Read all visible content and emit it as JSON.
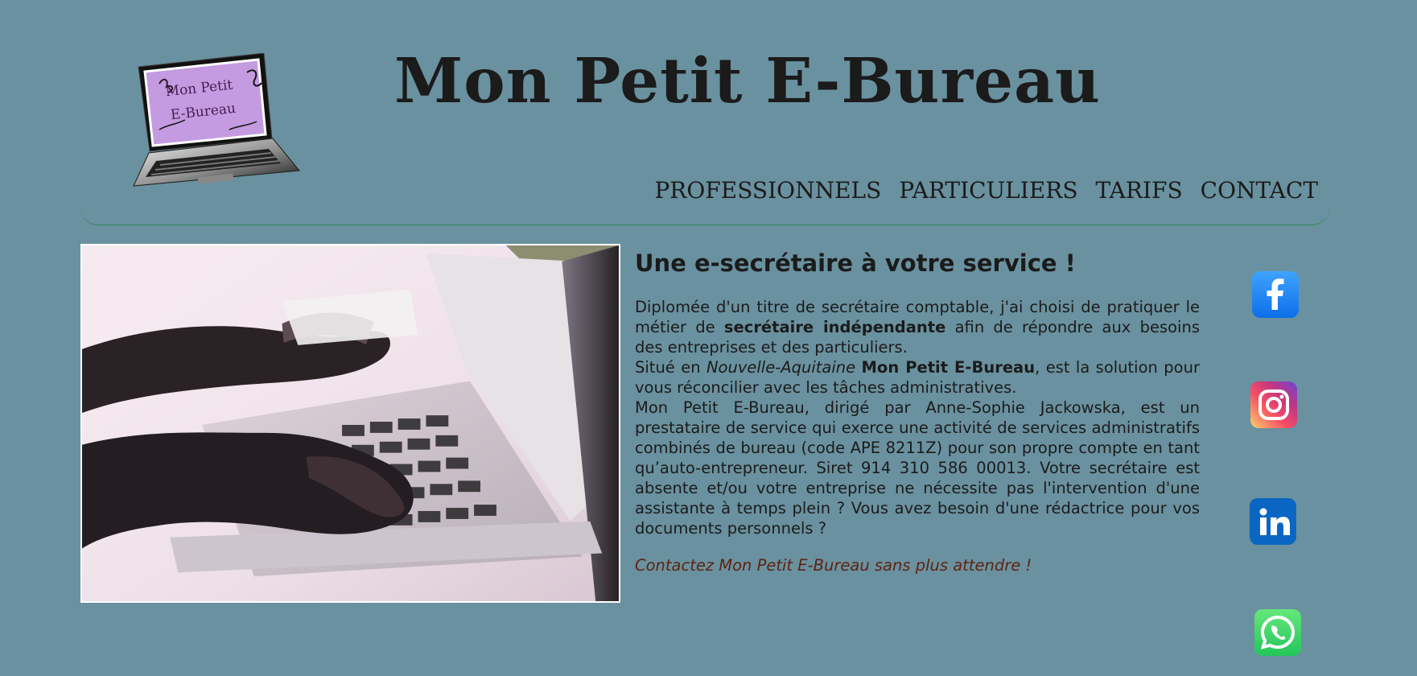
{
  "site": {
    "title": "Mon Petit E-Bureau",
    "logo_text": [
      "Mon Petit",
      "E-Bureau"
    ]
  },
  "navigation": [
    {
      "label": "PROFESSIONNELS"
    },
    {
      "label": "PARTICULIERS"
    },
    {
      "label": "TARIFS"
    },
    {
      "label": "CONTACT"
    }
  ],
  "main": {
    "heading": "Une e-secrétaire à votre service !",
    "paragraph_1": {
      "before": "Diplomée d'un titre de secrétaire comptable, j'ai choisi de pratiquer le métier de ",
      "bold": "secrétaire indépendante",
      "after": " afin de répondre aux besoins des entreprises et des particuliers."
    },
    "paragraph_2": {
      "before": "Situé en ",
      "italic": "Nouvelle-Aquitaine",
      "space": " ",
      "bold": "Mon Petit E-Bureau",
      "after": ", est la solution pour vous réconcilier avec les tâches administratives."
    },
    "paragraph_3": "Mon Petit E-Bureau, dirigé par Anne-Sophie Jackowska, est un prestataire de service qui exerce une activité de services administratifs combinés de bureau (code APE 8211Z) pour son propre compte en tant qu’auto-entrepreneur. Siret 914 310 586 00013. Votre secrétaire est absente et/ou votre entreprise ne nécessite pas l'intervention d'une assistante à temps plein ? Vous avez besoin d'une rédactrice pour vos documents personnels ?",
    "call_to_action": "Contactez Mon Petit E-Bureau sans plus attendre !"
  },
  "social_links": [
    {
      "name": "facebook",
      "icon": "facebook-icon",
      "color": "#1877f2"
    },
    {
      "name": "instagram",
      "icon": "instagram-icon",
      "color": "#e4405f"
    },
    {
      "name": "linkedin",
      "icon": "linkedin-icon",
      "color": "#0a66c2"
    },
    {
      "name": "whatsapp",
      "icon": "whatsapp-icon",
      "color": "#25d366"
    }
  ],
  "colors": {
    "background": "#6a919f",
    "header_rule": "#2e8b57",
    "cta": "#5e2311",
    "logo_screen": "#c49be0"
  }
}
